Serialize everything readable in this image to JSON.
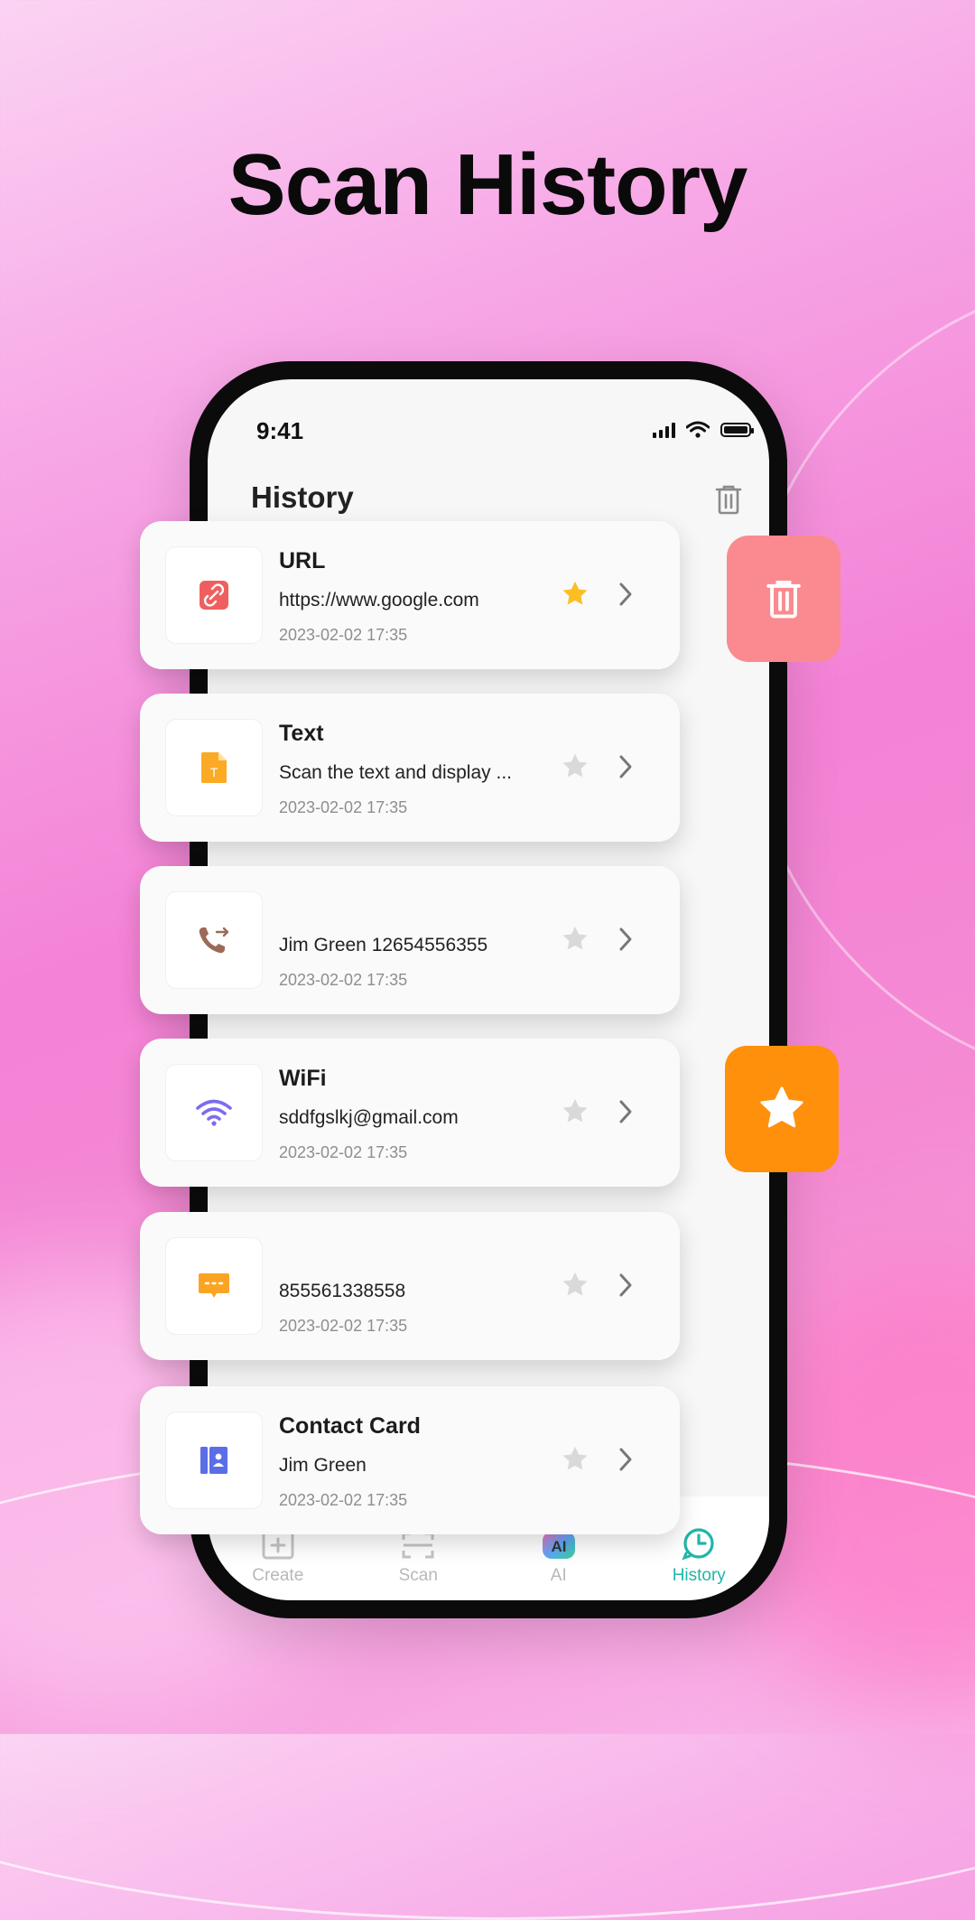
{
  "headline": "Scan History",
  "status": {
    "time": "9:41"
  },
  "screen": {
    "title": "History"
  },
  "tabs": [
    {
      "label": "Create",
      "icon": "plus-square-icon",
      "active": false
    },
    {
      "label": "Scan",
      "icon": "scan-icon",
      "active": false
    },
    {
      "label": "AI",
      "icon": "ai-icon",
      "active": false
    },
    {
      "label": "History",
      "icon": "clock-icon",
      "active": true
    }
  ],
  "items": [
    {
      "type": "url",
      "icon": "link-icon",
      "title": "URL",
      "content": "https://www.google.com",
      "date": "2023-02-02 17:35",
      "starred": true
    },
    {
      "type": "text",
      "icon": "text-file-icon",
      "title": "Text",
      "content": "Scan the  text and display ...",
      "date": "2023-02-02 17:35",
      "starred": false
    },
    {
      "type": "phone",
      "icon": "phone-icon",
      "title": "",
      "content": "Jim Green  12654556355",
      "date": "2023-02-02 17:35",
      "starred": false
    },
    {
      "type": "wifi",
      "icon": "wifi-icon",
      "title": "WiFi",
      "content": "sddfgslkj@gmail.com",
      "date": "2023-02-02 17:35",
      "starred": false
    },
    {
      "type": "sms",
      "icon": "message-icon",
      "title": "",
      "content": "855561338558",
      "date": "2023-02-02 17:35",
      "starred": false
    },
    {
      "type": "contact",
      "icon": "contact-card-icon",
      "title": "Contact Card",
      "content": "Jim Green",
      "date": "2023-02-02 17:35",
      "starred": false
    }
  ],
  "colors": {
    "accent": "#1fb6a8",
    "star_active": "#fbbf24",
    "star_inactive": "#d9d9d9",
    "delete_action": "#fb8a90",
    "favorite_action": "#ff900c"
  }
}
